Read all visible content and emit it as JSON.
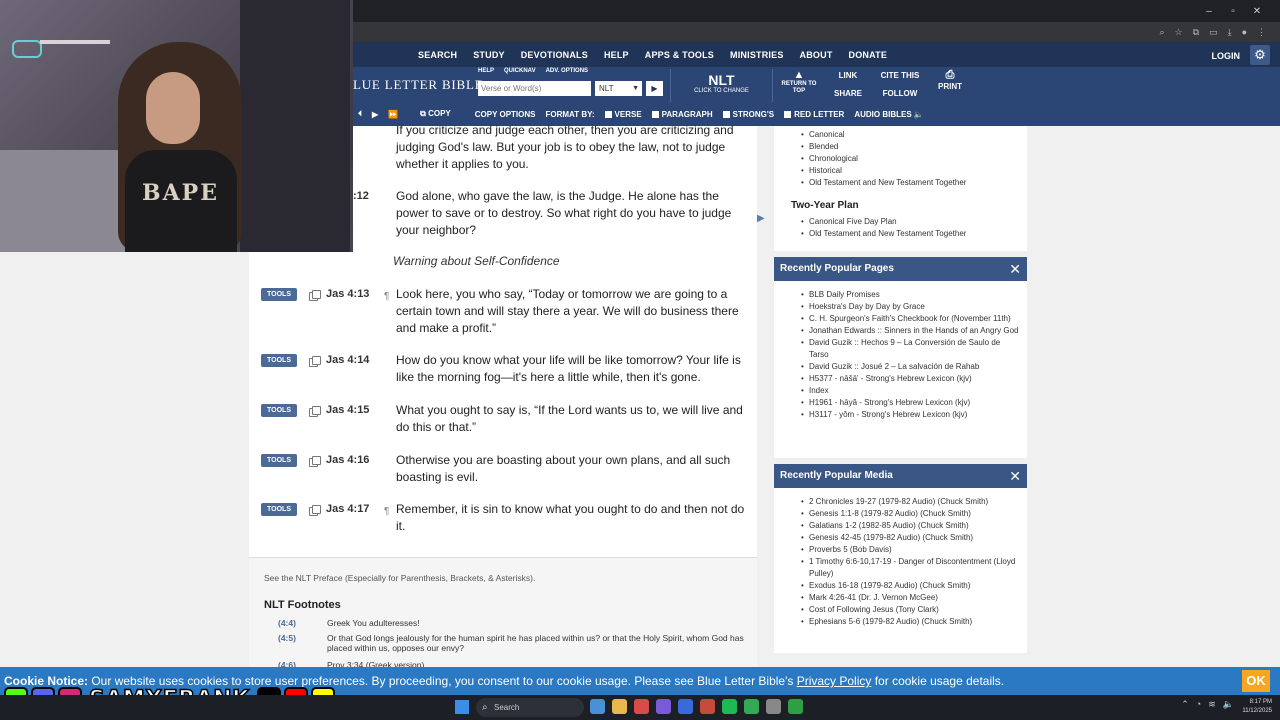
{
  "nav": {
    "items": [
      "SEARCH",
      "STUDY",
      "DEVOTIONALS",
      "HELP",
      "APPS & TOOLS",
      "MINISTRIES",
      "ABOUT",
      "DONATE"
    ],
    "login": "LOGIN"
  },
  "header": {
    "logo": "LUE LETTER BIBLE",
    "mini_links": [
      "HELP",
      "QUICKNAV",
      "ADV. OPTIONS"
    ],
    "search_placeholder": "Verse or Word(s)",
    "version": "NLT",
    "version_big": "NLT",
    "version_caption": "CLICK TO CHANGE",
    "return_top": "RETURN TO TOP",
    "link": "LINK",
    "share": "SHARE",
    "cite": "CITE THIS",
    "follow": "FOLLOW",
    "print": "PRINT"
  },
  "toolbar2": {
    "copy": "COPY",
    "copy_options": "COPY OPTIONS",
    "format_by": "FORMAT BY:",
    "verse": "VERSE",
    "paragraph": "PARAGRAPH",
    "strongs": "STRONG'S",
    "red_letter": "RED LETTER",
    "audio": "AUDIO BIBLES"
  },
  "passage": {
    "partial_top": "If you criticize and judge each other, then you are criticizing and judging God's law. But your job is to obey the law, not to judge whether it applies to you.",
    "ref_partial": ":12",
    "v12": "God alone, who gave the law, is the Judge. He alone has the power to save or to destroy. So what right do you have to judge your neighbor?",
    "heading": "Warning about Self-Confidence",
    "tools_label": "TOOLS",
    "pilcrow": "¶",
    "verses": [
      {
        "ref": "Jas 4:13",
        "text": "Look here, you who say, “Today or tomorrow we are going to a certain town and will stay there a year. We will do business there and make a profit.”"
      },
      {
        "ref": "Jas 4:14",
        "text": "How do you know what your life will be like tomorrow? Your life is like the morning fog—it's here a little while, then it's gone."
      },
      {
        "ref": "Jas 4:15",
        "text": "What you ought to say is, “If the Lord wants us to, we will live and do this or that.”"
      },
      {
        "ref": "Jas 4:16",
        "text": "Otherwise you are boasting about your own plans, and all such boasting is evil."
      },
      {
        "ref": "Jas 4:17",
        "text": "Remember, it is sin to know what you ought to do and then not do it."
      }
    ]
  },
  "notes": {
    "preface": "See the NLT Preface (Especially for Parenthesis, Brackets, & Asterisks).",
    "title": "NLT Footnotes",
    "footnotes": [
      {
        "ref": "(4:4)",
        "text": "Greek You adulteresses!"
      },
      {
        "ref": "(4:5)",
        "text": "Or that God longs jealously for the human spirit he has placed within us? or that the Holy Spirit, whom God has placed within us, opposes our envy?"
      },
      {
        "ref": "(4:6)",
        "text": "Prov 3:34 (Greek version)."
      }
    ]
  },
  "sidebar": {
    "plans_top": [
      "Canonical",
      "Blended",
      "Chronological",
      "Historical",
      "Old Testament and New Testament Together"
    ],
    "two_year_title": "Two-Year Plan",
    "two_year": [
      "Canonical Five Day Plan",
      "Old Testament and New Testament Together"
    ],
    "popular_pages_title": "Recently Popular Pages",
    "popular_pages": [
      "BLB Daily Promises",
      "Hoekstra's Day by Day by Grace",
      "C. H. Spurgeon's Faith's Checkbook for (November 11th)",
      "Jonathan Edwards :: Sinners in the Hands of an Angry God",
      "David Guzik :: Hechos 9 – La Conversión de Saulo de Tarso",
      "David Guzik :: Josué 2 – La salvación de Rahab",
      "H5377 - nāšā' - Strong's Hebrew Lexicon (kjv)",
      "Index",
      "H1961 - hāyâ - Strong's Hebrew Lexicon (kjv)",
      "H3117 - yôm - Strong's Hebrew Lexicon (kjv)"
    ],
    "popular_media_title": "Recently Popular Media",
    "popular_media": [
      "2 Chronicles 19-27 (1979-82 Audio) (Chuck Smith)",
      "Genesis 1:1-8 (1979-82 Audio) (Chuck Smith)",
      "Galatians 1-2 (1982-85 Audio) (Chuck Smith)",
      "Genesis 42-45 (1979-82 Audio) (Chuck Smith)",
      "Proverbs 5 (Bob Davis)",
      "1 Timothy 6:6-10,17-19 - Danger of Discontentment (Lloyd Pulley)",
      "Exodus 16-18 (1979-82 Audio) (Chuck Smith)",
      "Mark 4:26-41 (Dr. J. Vernon McGee)",
      "Cost of Following Jesus (Tony Clark)",
      "Ephesians 5-6 (1979-82 Audio) (Chuck Smith)"
    ]
  },
  "cookie": {
    "label": "Cookie Notice:",
    "text1": " Our website uses cookies to store user preferences. By proceeding, you consent to our cookie usage. Please see Blue Letter Bible's ",
    "link": "Privacy Policy",
    "text2": " for cookie usage details.",
    "ok": "OK"
  },
  "overlay": {
    "streamer_name": "SAMXFRANK",
    "shirt_text": "BAPE"
  },
  "taskbar": {
    "search": "Search",
    "time": "8:17 PM",
    "date": "11/12/2025"
  },
  "colors": {
    "nav_bg": "#1f3457",
    "toolbar_bg": "#2b4574",
    "tools_badge": "#4c6a96",
    "cookie_bg": "#2b79c2",
    "ok_bg": "#f5a623"
  }
}
